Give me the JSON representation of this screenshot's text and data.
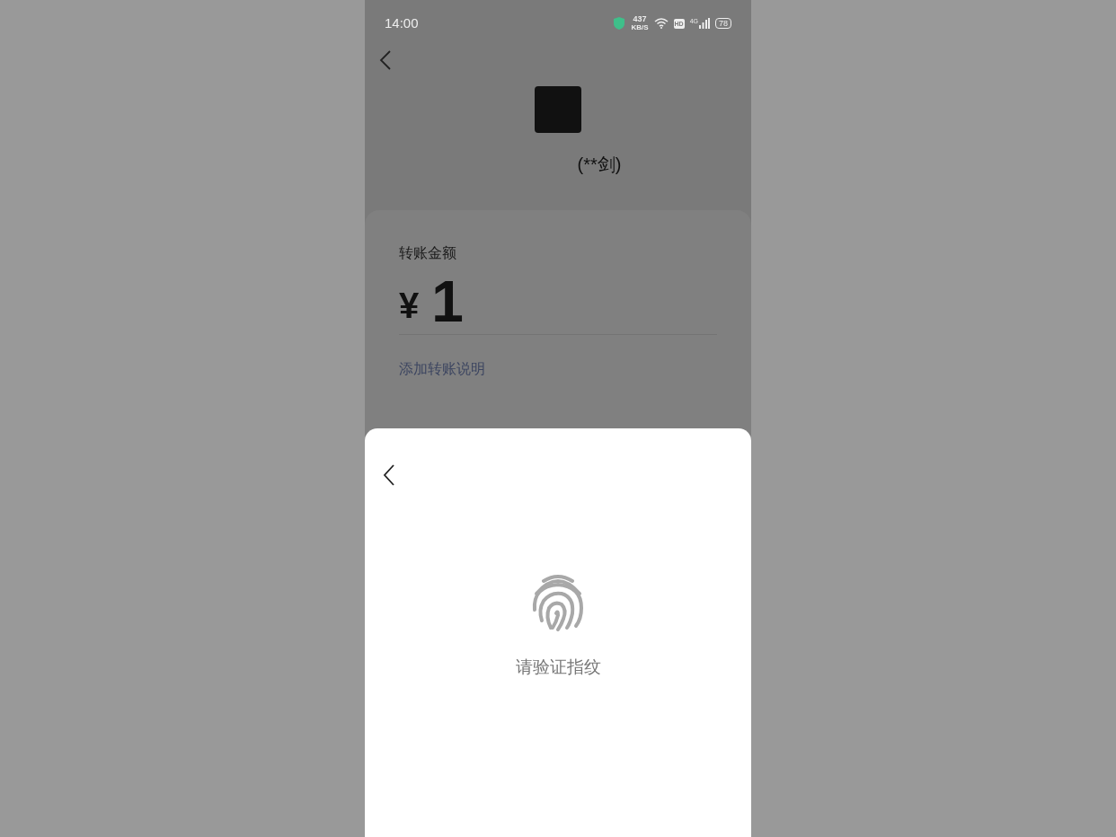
{
  "status_bar": {
    "time": "14:00",
    "net_speed": "437",
    "net_unit": "KB/S",
    "hd": "HD",
    "network": "4G",
    "battery": "78"
  },
  "recipient": {
    "name": "(**剑)"
  },
  "transfer": {
    "label": "转账金额",
    "currency": "¥",
    "amount": "1",
    "note_link": "添加转账说明"
  },
  "sheet": {
    "prompt": "请验证指纹"
  }
}
